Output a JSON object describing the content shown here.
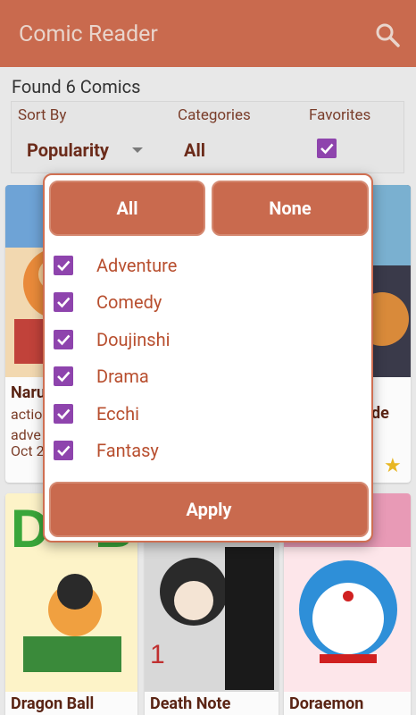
{
  "app": {
    "title": "Comic Reader"
  },
  "list": {
    "found_text": "Found 6 Comics"
  },
  "filters": {
    "sort_by": {
      "label": "Sort By",
      "value": "Popularity"
    },
    "categories": {
      "label": "Categories",
      "value": "All"
    },
    "favorites": {
      "label": "Favorites",
      "checked": true
    }
  },
  "comics": [
    {
      "title": "Naru",
      "lines": [
        "actio",
        "adve",
        "Oct 2"
      ]
    },
    {
      "title": "de",
      "lines": []
    },
    {
      "title": "Dragon Ball",
      "lines": []
    },
    {
      "title": "Death Note",
      "lines": []
    },
    {
      "title": "Doraemon",
      "lines": []
    }
  ],
  "dialog": {
    "all_label": "All",
    "none_label": "None",
    "apply_label": "Apply",
    "categories": [
      {
        "name": "Adventure",
        "checked": true
      },
      {
        "name": "Comedy",
        "checked": true
      },
      {
        "name": "Doujinshi",
        "checked": true
      },
      {
        "name": "Drama",
        "checked": true
      },
      {
        "name": "Ecchi",
        "checked": true
      },
      {
        "name": "Fantasy",
        "checked": true
      }
    ]
  },
  "colors": {
    "primary": "#c96a4e",
    "checkbox": "#8e44ad",
    "category_text": "#b84f2f"
  }
}
